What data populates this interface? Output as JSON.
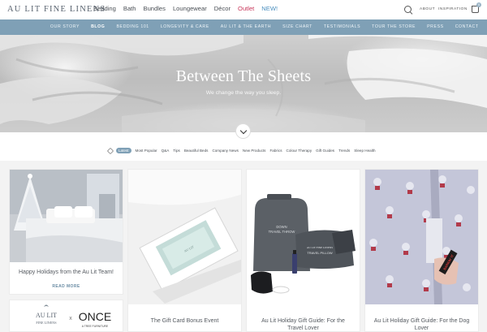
{
  "header": {
    "logo": "AU LIT FINE LINENS",
    "nav": [
      "Bedding",
      "Bath",
      "Bundles",
      "Loungewear",
      "Décor"
    ],
    "outlet": "Outlet",
    "new": "NEW!",
    "about": "ABOUT",
    "inspiration": "INSPIRATION",
    "cart_count": "0",
    "icons": {
      "search": "search-icon",
      "cart": "bag-icon"
    },
    "colors": {
      "outlet": "#c8375a",
      "new": "#4a8fbf",
      "subnav": "#7fa0b6"
    }
  },
  "subnav": {
    "items": [
      "OUR STORY",
      "BLOG",
      "BEDDING 101",
      "LONGEVITY & CARE",
      "AU LIT & THE EARTH",
      "SIZE CHART",
      "TESTIMONIALS",
      "TOUR THE STORE",
      "PRESS",
      "CONTACT"
    ]
  },
  "hero": {
    "title": "Between The Sheets",
    "subtitle": "We change the way you sleep."
  },
  "tags": {
    "selected": "Latest",
    "items": [
      "Most Popular",
      "Q&A",
      "Tips",
      "Beautiful Beds",
      "Company News",
      "New Products",
      "Fabrics",
      "Colour Therapy",
      "Gift Guides",
      "Trends",
      "Sleep Health"
    ]
  },
  "cards": [
    {
      "title": "Happy Holidays from the Au Lit Team!",
      "more": "READ MORE"
    },
    {
      "title": "The Gift Card Bonus Event"
    },
    {
      "title_line1": "Au Lit Holiday Gift Guide: For the",
      "title_line2": "Travel Lover"
    },
    {
      "title_line1": "Au Lit Holiday Gift Guide: For the Dog",
      "title_line2": "Lover"
    },
    {
      "logo_left_top": "AU LIT",
      "logo_left_bottom": "FINE LINENS",
      "x": "x",
      "logo_right": "ONCE",
      "logo_right_sub": "A TREE FURNITURE"
    }
  ],
  "product_text": {
    "bag_label_1": "DOWN",
    "bag_label_2": "TRAVEL THROW",
    "pillow_brand": "AU LIT FINE LINENS",
    "pillow_label": "TRAVEL PILLOW",
    "pj_patch": "BARKIN' IT"
  }
}
